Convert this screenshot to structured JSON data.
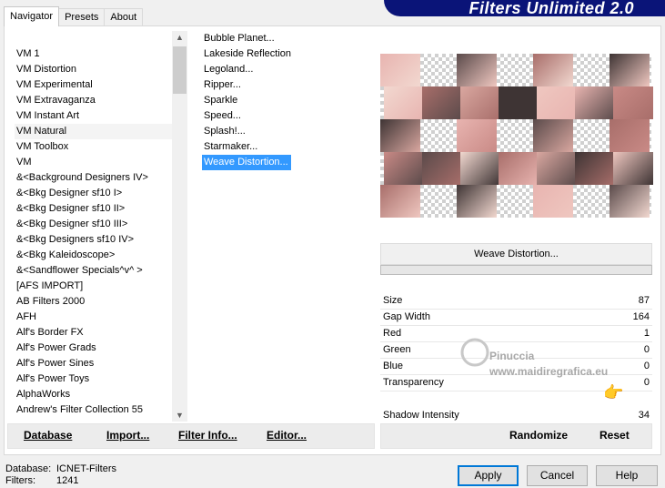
{
  "tabs": [
    "Navigator",
    "Presets",
    "About"
  ],
  "banner_title": "Filters Unlimited 2.0",
  "categories": [
    "VM 1",
    "VM Distortion",
    "VM Experimental",
    "VM Extravaganza",
    "VM Instant Art",
    "VM Natural",
    "VM Toolbox",
    "VM",
    "&<Background Designers IV>",
    "&<Bkg Designer sf10 I>",
    "&<Bkg Designer sf10 II>",
    "&<Bkg Designer sf10 III>",
    "&<Bkg Designers sf10 IV>",
    "&<Bkg Kaleidoscope>",
    "&<Sandflower Specials^v^ >",
    "[AFS IMPORT]",
    "AB Filters 2000",
    "AFH",
    "Alf's Border FX",
    "Alf's Power Grads",
    "Alf's Power Sines",
    "Alf's Power Toys",
    "AlphaWorks",
    "Andrew's Filter Collection 55"
  ],
  "selected_category": "VM Natural",
  "filters": [
    "Bubble Planet...",
    "Lakeside Reflection",
    "Legoland...",
    "Ripper...",
    "Sparkle",
    "Speed...",
    "Splash!...",
    "Starmaker...",
    "Weave Distortion..."
  ],
  "selected_filter": "Weave Distortion...",
  "left_buttons": [
    "Database",
    "Import...",
    "Filter Info...",
    "Editor..."
  ],
  "right_buttons": [
    "Randomize",
    "Reset"
  ],
  "filter_label": "Weave Distortion...",
  "params": [
    {
      "name": "Size",
      "value": "87"
    },
    {
      "name": "Gap Width",
      "value": "164"
    },
    {
      "name": "Red",
      "value": "1"
    },
    {
      "name": "Green",
      "value": "0"
    },
    {
      "name": "Blue",
      "value": "0"
    },
    {
      "name": "Transparency",
      "value": "0"
    },
    {
      "name": "Shadow Intensity",
      "value": "34"
    }
  ],
  "watermark": {
    "line1": "Pinuccia",
    "line2": "www.maidiregrafica.eu"
  },
  "status": {
    "db_label": "Database:",
    "db_value": "ICNET-Filters",
    "filters_label": "Filters:",
    "filters_value": "1241"
  },
  "dialog_buttons": [
    "Apply",
    "Cancel",
    "Help"
  ]
}
